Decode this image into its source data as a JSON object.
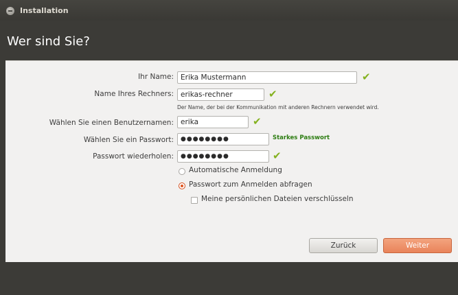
{
  "window": {
    "title": "Installation"
  },
  "page": {
    "title": "Wer sind Sie?"
  },
  "form": {
    "name_label": "Ihr Name:",
    "name_value": "Erika Mustermann",
    "computer_label": "Name Ihres Rechners:",
    "computer_value": "erikas-rechner",
    "computer_hint": "Der Name, der bei der Kommunikation mit anderen Rechnern verwendet wird.",
    "username_label": "Wählen Sie einen Benutzernamen:",
    "username_value": "erika",
    "password_label": "Wählen Sie ein Passwort:",
    "password_value": "●●●●●●●●",
    "password_strength": "Starkes Passwort",
    "repeat_label": "Passwort wiederholen:",
    "repeat_value": "●●●●●●●●"
  },
  "login_options": {
    "auto_login": "Automatische Anmeldung",
    "require_password": "Passwort zum Anmelden abfragen",
    "selected": "require_password",
    "encrypt_home": "Meine persönlichen Dateien verschlüsseln",
    "encrypt_home_checked": false
  },
  "buttons": {
    "back": "Zurück",
    "next": "Weiter"
  },
  "icons": {
    "valid": "checkmark-icon",
    "close": "close-icon"
  },
  "colors": {
    "accent": "#e0531c",
    "valid": "#84b11f",
    "strength": "#2d7d12",
    "header_bg": "#3c3b37"
  }
}
